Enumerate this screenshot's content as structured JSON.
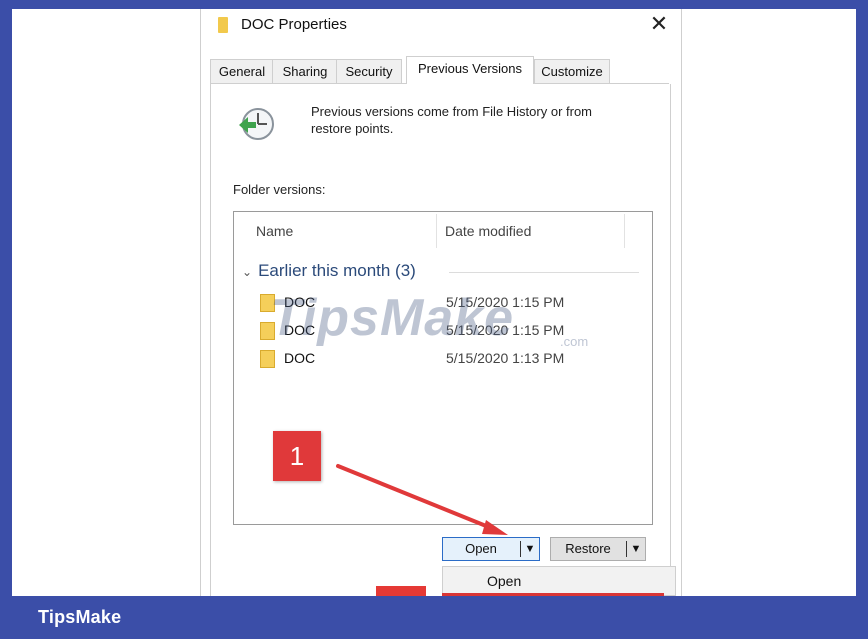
{
  "dialog": {
    "title": "DOC Properties",
    "close_label": "✕",
    "tabs": [
      {
        "label": "General"
      },
      {
        "label": "Sharing"
      },
      {
        "label": "Security"
      },
      {
        "label": "Previous Versions",
        "active": true
      },
      {
        "label": "Customize"
      }
    ],
    "info_text": "Previous versions come from File History or from restore points.",
    "folder_versions_label": "Folder versions:",
    "list": {
      "columns": [
        "Name",
        "Date modified"
      ],
      "group": "Earlier this month (3)",
      "rows": [
        {
          "name": "DOC",
          "date": "5/15/2020 1:15 PM"
        },
        {
          "name": "DOC",
          "date": "5/15/2020 1:15 PM"
        },
        {
          "name": "DOC",
          "date": "5/15/2020 1:13 PM"
        }
      ]
    },
    "buttons": {
      "open_label": "Open",
      "restore_label": "Restore",
      "dropdown_arrow": "▼"
    },
    "dropdown": {
      "items": [
        "Open"
      ]
    }
  },
  "annotation": {
    "step_number": "1",
    "color": "#e0393a"
  },
  "watermark": {
    "text": "TipsMake",
    "suffix": ".com"
  },
  "footer": {
    "brand": "TipsMake"
  },
  "colors": {
    "frame": "#3b4ea8",
    "accent": "#2b6cc7",
    "folder": "#f5cf5a"
  }
}
